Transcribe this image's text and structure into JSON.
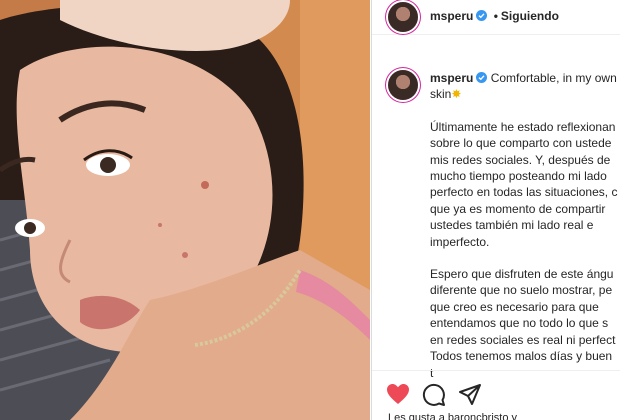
{
  "post": {
    "username": "msperu",
    "follow_status": "Siguiendo",
    "separator": "•",
    "caption_first": "Comfortable, in my own",
    "caption_second": "skin",
    "paragraph1": "Últimamente he estado reflexionan\nsobre lo que comparto con ustede\nmis redes sociales. Y, después de\nmucho tiempo posteando mi lado\nperfecto en todas las situaciones, c\nque ya es momento de compartir\nustedes también mi lado real e\nimperfecto.",
    "paragraph2": "Espero que disfruten de este ángu\ndiferente que no suelo mostrar, pe\nque creo es necesario para que\nentendamos que no todo lo que s\nen redes sociales es real ni perfect\nTodos tenemos malos días y buen\nt",
    "likes_text": "Les gusta a baroncbristo y"
  },
  "icons": {
    "like": "heart-icon",
    "comment": "comment-icon",
    "share": "paper-plane-icon",
    "verified": "verified-badge-icon",
    "sparkle": "sparkle-emoji-icon"
  },
  "colors": {
    "like_red": "#ed4956",
    "verified_blue": "#3897f0",
    "text": "#262626"
  }
}
